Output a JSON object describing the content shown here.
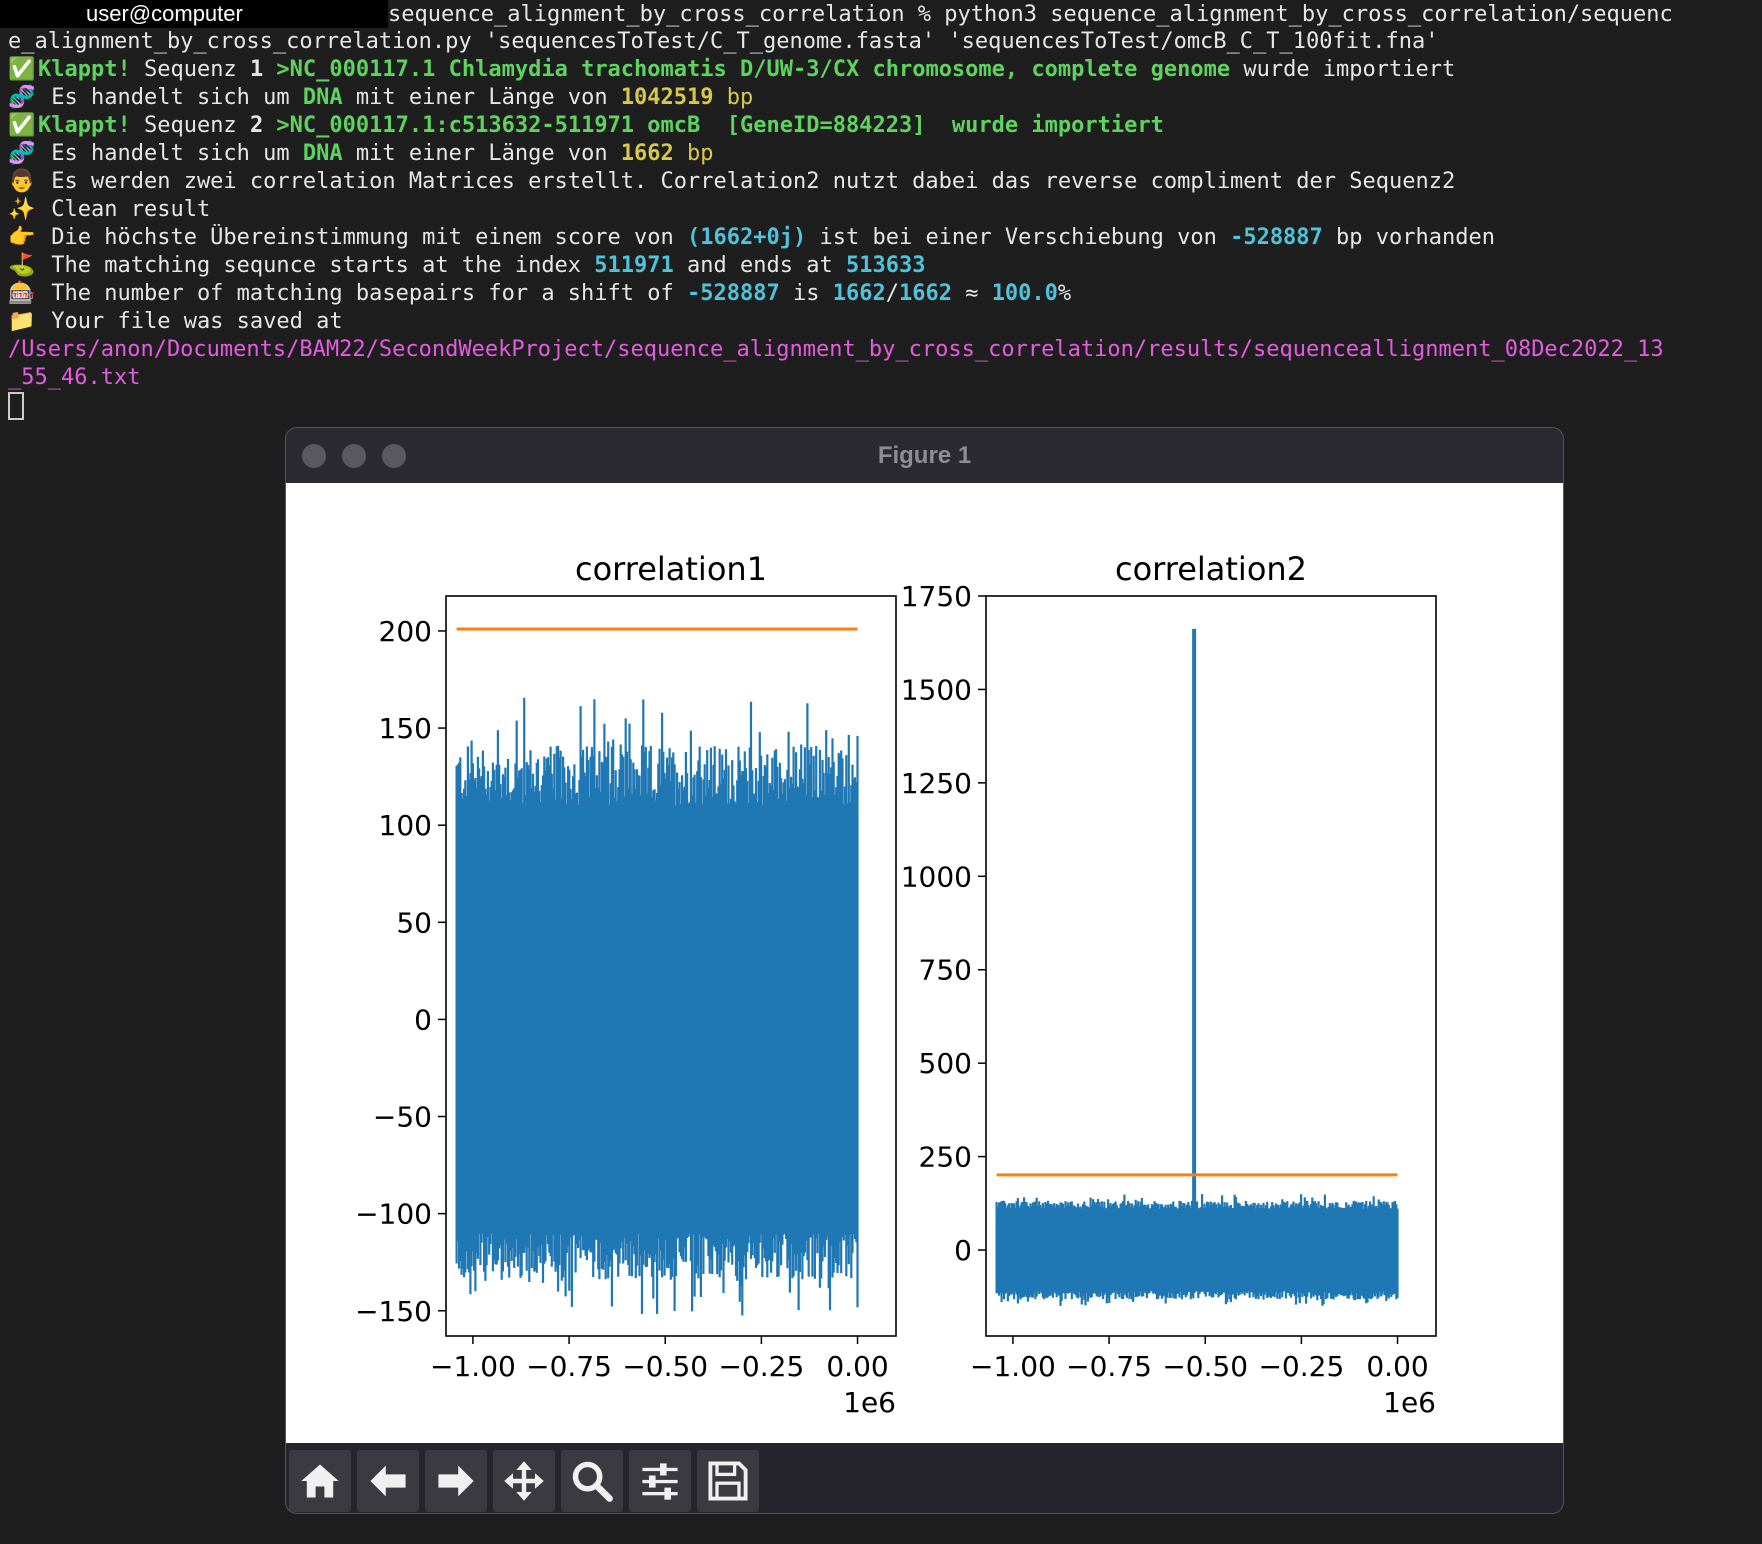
{
  "terminal": {
    "user_label": "user@computer",
    "command_part1": "sequence_alignment_by_cross_correlation % python3 sequence_alignment_by_cross_correlation/sequenc",
    "command_part2": "e_alignment_by_cross_correlation.py 'sequencesToTest/C_T_genome.fasta' 'sequencesToTest/omcB_C_T_100fit.fna'",
    "lines": {
      "l1": {
        "icon": "✅",
        "klappt": "Klappt!",
        "seq_word": " Sequenz ",
        "seq_num": "1",
        "name": " >NC_000117.1 Chlamydia trachomatis D/UW-3/CX chromosome, complete genome",
        "rest": " wurde importiert"
      },
      "l2": {
        "icon": "🧬",
        "pre": " Es handelt sich um ",
        "dna": "DNA",
        "mid": " mit einer Länge von ",
        "len": "1042519",
        "bp": " bp"
      },
      "l3": {
        "icon": "✅",
        "klappt": "Klappt!",
        "seq_word": " Sequenz ",
        "seq_num": "2",
        "name": " >NC_000117.1:c513632-511971 omcB  [GeneID=884223]  wurde importiert"
      },
      "l4": {
        "icon": "🧬",
        "pre": " Es handelt sich um ",
        "dna": "DNA",
        "mid": " mit einer Länge von ",
        "len": "1662",
        "bp": " bp"
      },
      "l5": {
        "icon": "👨",
        "text": " Es werden zwei correlation Matrices erstellt. Correlation2 nutzt dabei das reverse compliment der Sequenz2"
      },
      "l6": {
        "icon": "✨",
        "text": " Clean result"
      },
      "l7": {
        "icon": "👉",
        "pre": " Die höchste Übereinstimmung mit einem score von ",
        "score": "(1662+0j)",
        "mid": " ist bei einer Verschiebung von ",
        "shift": "-528887",
        "post": " bp vorhanden"
      },
      "l8": {
        "icon": "⛳",
        "pre": " The matching sequnce starts at the index ",
        "start": "511971",
        "mid": " and ends at ",
        "end": "513633"
      },
      "l9": {
        "icon": "🎰",
        "pre": " The number of matching basepairs for a shift of ",
        "shift": "-528887",
        "mid": " is ",
        "a": "1662",
        "slash": "/",
        "b": "1662",
        "approx": " ≈ ",
        "pct": "100.0",
        "pctsign": "%"
      },
      "l10": {
        "icon": "📁",
        "text": " Your file was saved at"
      },
      "path1": "/Users/anon/Documents/BAM22/SecondWeekProject/sequence_alignment_by_cross_correlation/results/sequenceallignment_08Dec2022_13",
      "path2": "_55_46.txt"
    }
  },
  "figure": {
    "window_title": "Figure 1",
    "toolbar": {
      "home": "home-icon",
      "back": "arrow-left-icon",
      "forward": "arrow-right-icon",
      "pan": "move-icon",
      "zoom": "magnifier-icon",
      "configure": "sliders-icon",
      "save": "floppy-disk-icon"
    }
  },
  "colors": {
    "series": "#1f77b4",
    "threshold": "#ff7f0e",
    "green": "#5fd35f",
    "yellow": "#d6c84a",
    "cyan": "#4fc3d9",
    "pink": "#e45ce0"
  },
  "chart_data": [
    {
      "type": "line",
      "title": "correlation1",
      "xlabel": "",
      "ylabel": "",
      "x_offset_label": "1e6",
      "xlim": [
        -1.07,
        0.1
      ],
      "ylim": [
        -163,
        218
      ],
      "xticks": [
        -1.0,
        -0.75,
        -0.5,
        -0.25,
        0.0
      ],
      "xtick_labels": [
        "−1.00",
        "−0.75",
        "−0.50",
        "−0.25",
        "0.00"
      ],
      "yticks": [
        200,
        150,
        100,
        50,
        0,
        -50,
        -100,
        -150
      ],
      "ytick_labels": [
        "200",
        "150",
        "100",
        "50",
        "0",
        "−50",
        "−100",
        "−150"
      ],
      "series": [
        {
          "kind": "noise",
          "x_range": [
            -1.0425,
            0
          ],
          "base_amplitude": 110,
          "peak_max": 167,
          "peak_min": -155
        },
        {
          "kind": "hline",
          "y": 201,
          "x_range": [
            -1.0425,
            0
          ]
        }
      ]
    },
    {
      "type": "line",
      "title": "correlation2",
      "xlabel": "",
      "ylabel": "",
      "x_offset_label": "1e6",
      "xlim": [
        -1.07,
        0.1
      ],
      "ylim": [
        -230,
        1750
      ],
      "xticks": [
        -1.0,
        -0.75,
        -0.5,
        -0.25,
        0.0
      ],
      "xtick_labels": [
        "−1.00",
        "−0.75",
        "−0.50",
        "−0.25",
        "0.00"
      ],
      "yticks": [
        1750,
        1500,
        1250,
        1000,
        750,
        500,
        250,
        0
      ],
      "ytick_labels": [
        "1750",
        "1500",
        "1250",
        "1000",
        "750",
        "500",
        "250",
        "0"
      ],
      "series": [
        {
          "kind": "noise",
          "x_range": [
            -1.0425,
            0
          ],
          "base_amplitude": 110,
          "peak_max": 150,
          "peak_min": -150
        },
        {
          "kind": "spike",
          "x": -0.528887,
          "y": 1662
        },
        {
          "kind": "hline",
          "y": 201,
          "x_range": [
            -1.0425,
            0
          ]
        }
      ]
    }
  ]
}
